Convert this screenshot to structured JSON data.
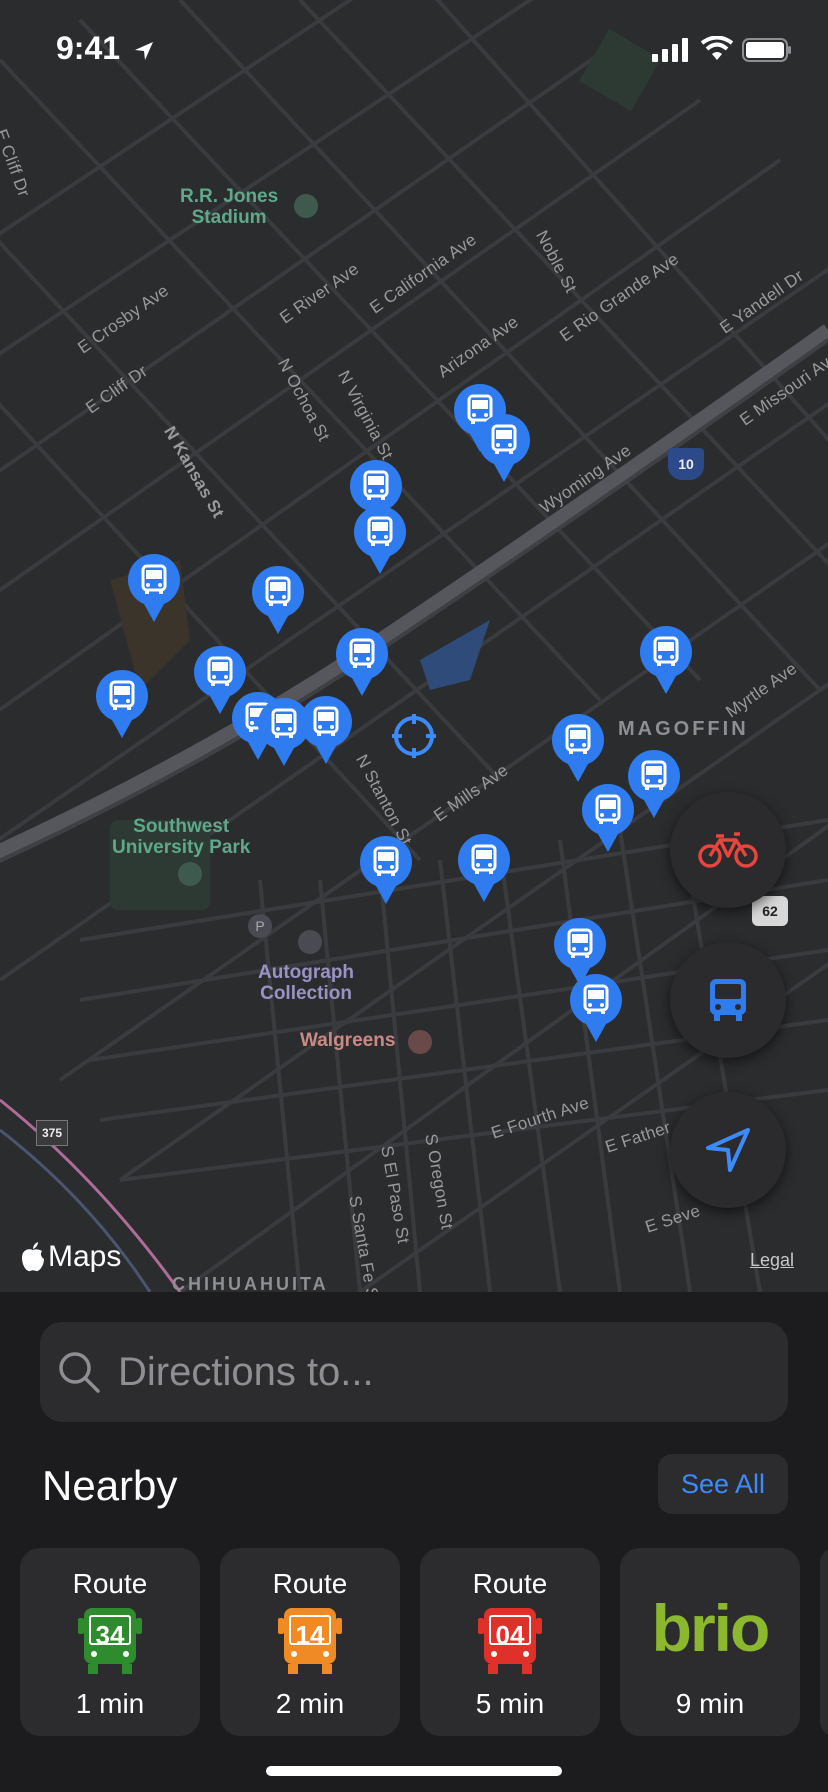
{
  "status": {
    "time": "9:41"
  },
  "map": {
    "streets": [
      "E Cliff Dr",
      "E Crosby Ave",
      "E Cliff Dr",
      "N Kansas St",
      "N Ochoa St",
      "N Virginia St",
      "E River Ave",
      "E California Ave",
      "Arizona Ave",
      "Noble St",
      "E Rio Grande Ave",
      "E Yandell Dr",
      "E Missouri Ave",
      "Wyoming Ave",
      "N Stanton St",
      "E Mills Ave",
      "Myrtle Ave",
      "E Fourth Ave",
      "E Father",
      "S El Paso St",
      "S Oregon St",
      "S Santa Fe St",
      "E Seve"
    ],
    "pois": {
      "stadium": "R.R. Jones\nStadium",
      "park": "Southwest\nUniversity Park",
      "hotel": "Autograph\nCollection",
      "pharmacy": "Walgreens"
    },
    "district": "MAGOFFIN",
    "district_bottom": "CHIHUAHUITA",
    "shields": {
      "i10": "10",
      "us62": "62",
      "loop375": "375"
    },
    "maps_label": "Maps",
    "legal": "Legal"
  },
  "search": {
    "placeholder": "Directions to..."
  },
  "nearby": {
    "title": "Nearby",
    "see_all": "See All",
    "routes": [
      {
        "label": "Route",
        "number": "34",
        "eta": "1 min",
        "color": "#2e8b2e"
      },
      {
        "label": "Route",
        "number": "14",
        "eta": "2 min",
        "color": "#f08a24"
      },
      {
        "label": "Route",
        "number": "04",
        "eta": "5 min",
        "color": "#e0302a"
      }
    ],
    "brio": {
      "name": "brio",
      "eta": "9 min",
      "color": "#8bb82c"
    }
  },
  "colors": {
    "accent": "#3b8bff",
    "bus_pin": "#2f7bf0",
    "bike": "#e8453c"
  }
}
